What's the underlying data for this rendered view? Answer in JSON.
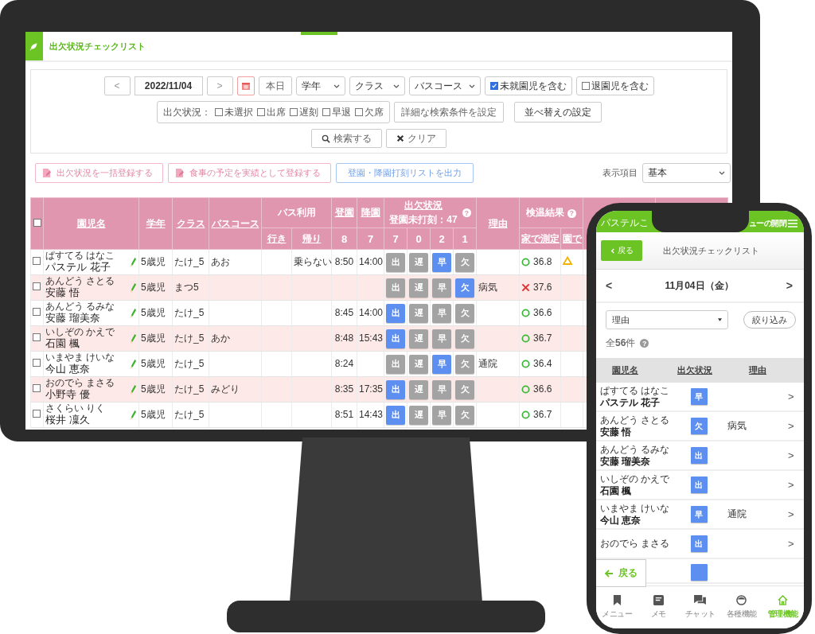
{
  "desktop": {
    "page_title": "出欠状況チェックリスト",
    "filters": {
      "prev": "<",
      "date": "2022/11/04",
      "next": ">",
      "today": "本日",
      "selects": [
        "学年",
        "クラス",
        "バスコース"
      ],
      "toggles": [
        {
          "label": "未就園児を含む",
          "checked": true
        },
        {
          "label": "退園児を含む",
          "checked": false
        }
      ],
      "status_label": "出欠状況：",
      "status_options": [
        {
          "label": "未選択",
          "checked": false
        },
        {
          "label": "出席",
          "checked": false
        },
        {
          "label": "遅刻",
          "checked": false
        },
        {
          "label": "早退",
          "checked": false
        },
        {
          "label": "欠席",
          "checked": false
        }
      ],
      "detail_button": "詳細な検索条件を設定",
      "sort_button": "並べ替えの設定",
      "search_button": "検索する",
      "clear_button": "クリア"
    },
    "actions": [
      {
        "label": "出欠状況を一括登録する",
        "kind": "pink"
      },
      {
        "label": "食事の予定を実績として登録する",
        "kind": "pink"
      },
      {
        "label": "登園・降園打刻リストを出力",
        "kind": "blue"
      }
    ],
    "display": {
      "label": "表示項目",
      "value": "基本"
    },
    "table": {
      "select_all": false,
      "columns": {
        "name": "園児名",
        "grade": "学年",
        "class": "クラス",
        "course": "バスコース",
        "bus": "バス利用",
        "bus_go": "行き",
        "bus_back": "帰り",
        "arrive": "登園",
        "arrive_count": "8",
        "leave": "降園",
        "leave_count": "7",
        "attendance": "出欠状況",
        "attendance_note": "登園未打刻：47",
        "attendance_help": "?",
        "temp_help": "?",
        "attendance_counts": [
          "7",
          "0",
          "2",
          "1"
        ],
        "reason": "理由",
        "temp": "検温結果",
        "temp_home": "家で測定",
        "temp_school": "園で"
      },
      "rows": [
        {
          "checked": false,
          "kana": "ぱすてる はなこ",
          "name": "パステル 花子",
          "grade": "5歳児",
          "class": "たけ_5",
          "course": "あお",
          "bus_back": "乗らない",
          "arrive": "8:50",
          "leave": "14:00",
          "marks": [
            {
              "label": "出",
              "selected": false
            },
            {
              "label": "遅",
              "selected": false
            },
            {
              "label": "早",
              "selected": true
            },
            {
              "label": "欠",
              "selected": false
            }
          ],
          "temp_home": {
            "kind": "ok",
            "value": "36.8"
          },
          "temp_school": {
            "kind": "warn"
          }
        },
        {
          "checked": false,
          "kana": "あんどう さとる",
          "name": "安藤 悟",
          "grade": "5歳児",
          "class": "まつ5",
          "marks": [
            {
              "label": "出",
              "selected": false
            },
            {
              "label": "遅",
              "selected": false
            },
            {
              "label": "早",
              "selected": false
            },
            {
              "label": "欠",
              "selected": true
            }
          ],
          "reason": "病気",
          "temp_home": {
            "kind": "ng",
            "value": "37.6"
          }
        },
        {
          "checked": false,
          "kana": "あんどう るみな",
          "name": "安藤 瑠美奈",
          "grade": "5歳児",
          "class": "たけ_5",
          "arrive": "8:45",
          "leave": "14:00",
          "marks": [
            {
              "label": "出",
              "selected": true
            },
            {
              "label": "遅",
              "selected": false
            },
            {
              "label": "早",
              "selected": false
            },
            {
              "label": "欠",
              "selected": false
            }
          ],
          "temp_home": {
            "kind": "ok",
            "value": "36.6"
          }
        },
        {
          "checked": false,
          "kana": "いしぞの かえで",
          "name": "石園 楓",
          "grade": "5歳児",
          "class": "たけ_5",
          "course": "あか",
          "arrive": "8:48",
          "leave": "15:43",
          "marks": [
            {
              "label": "出",
              "selected": true
            },
            {
              "label": "遅",
              "selected": false
            },
            {
              "label": "早",
              "selected": false
            },
            {
              "label": "欠",
              "selected": false
            }
          ],
          "temp_home": {
            "kind": "ok",
            "value": "36.7"
          }
        },
        {
          "checked": false,
          "kana": "いまやま けいな",
          "name": "今山 恵奈",
          "grade": "5歳児",
          "class": "たけ_5",
          "arrive": "8:24",
          "marks": [
            {
              "label": "出",
              "selected": false
            },
            {
              "label": "遅",
              "selected": false
            },
            {
              "label": "早",
              "selected": true
            },
            {
              "label": "欠",
              "selected": false
            }
          ],
          "reason": "通院",
          "temp_home": {
            "kind": "ok",
            "value": "36.4"
          }
        },
        {
          "checked": false,
          "kana": "おのでら まさる",
          "name": "小野寺 優",
          "grade": "5歳児",
          "class": "たけ_5",
          "course": "みどり",
          "arrive": "8:35",
          "leave": "17:35",
          "marks": [
            {
              "label": "出",
              "selected": true
            },
            {
              "label": "遅",
              "selected": false
            },
            {
              "label": "早",
              "selected": false
            },
            {
              "label": "欠",
              "selected": false
            }
          ],
          "temp_home": {
            "kind": "ok",
            "value": "36.6"
          }
        },
        {
          "checked": false,
          "kana": "さくらい りく",
          "name": "桜井 凜久",
          "grade": "5歳児",
          "class": "たけ_5",
          "arrive": "8:51",
          "leave": "14:43",
          "marks": [
            {
              "label": "出",
              "selected": true
            },
            {
              "label": "遅",
              "selected": false
            },
            {
              "label": "早",
              "selected": false
            },
            {
              "label": "欠",
              "selected": false
            }
          ],
          "temp_home": {
            "kind": "ok",
            "value": "36.7"
          }
        }
      ]
    }
  },
  "phone": {
    "status_left": "パステルこ",
    "status_right": "ューの開閉",
    "back": "戻る",
    "title": "出欠状況チェックリスト",
    "prev": "<",
    "date": "11月04日（金）",
    "next": ">",
    "select": "理由",
    "filter_button": "絞り込み",
    "count": "全**56**件",
    "count_help": "?",
    "columns": [
      "園児名",
      "出欠状況",
      "理由"
    ],
    "rows": [
      {
        "kana": "ぱすてる はなこ",
        "name": "パステル 花子",
        "status": "早",
        "chevron": ">"
      },
      {
        "kana": "あんどう さとる",
        "name": "安藤 悟",
        "status": "欠",
        "reason": "病気",
        "chevron": ">"
      },
      {
        "kana": "あんどう るみな",
        "name": "安藤 瑠美奈",
        "status": "出",
        "chevron": ">"
      },
      {
        "kana": "いしぞの かえで",
        "name": "石園 楓",
        "status": "出",
        "chevron": ">"
      },
      {
        "kana": "いまやま けいな",
        "name": "今山 恵奈",
        "status": "早",
        "reason": "通院",
        "chevron": ">"
      },
      {
        "kana": "おのでら まさる",
        "status": "出",
        "chevron": ">"
      }
    ],
    "floating_back": "戻る",
    "nav": [
      {
        "label": "メニュー",
        "selected": false
      },
      {
        "label": "メモ",
        "selected": false
      },
      {
        "label": "チャット",
        "selected": false
      },
      {
        "label": "各種機能",
        "selected": false
      },
      {
        "label": "管理機能",
        "selected": true
      }
    ]
  }
}
